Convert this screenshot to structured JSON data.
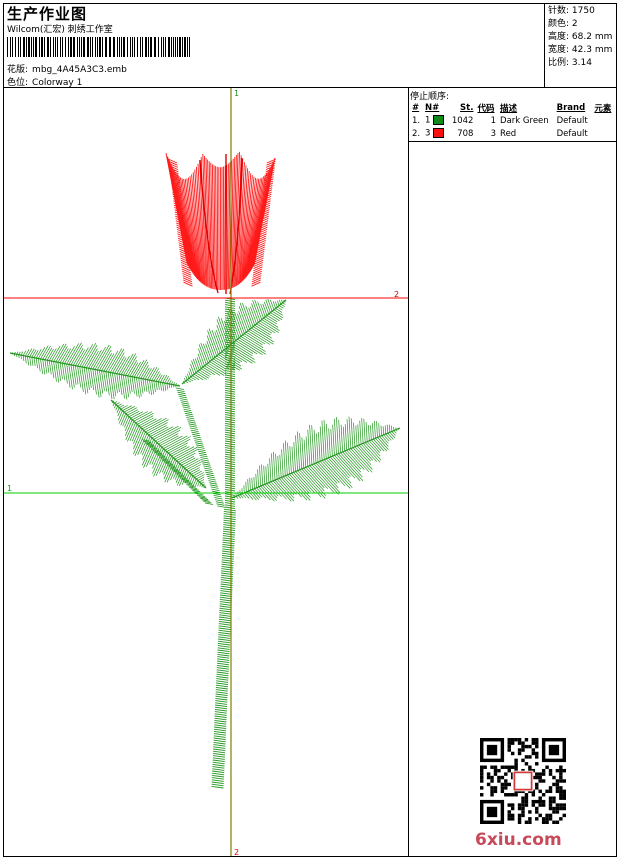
{
  "header": {
    "title": "生产作业图",
    "subtitle": "Wilcom(汇宏) 刺绣工作室",
    "design_label": "花版:",
    "design_value": "mbg_4A45A3C3.emb",
    "colorway_label": "色位:",
    "colorway_value": "Colorway 1"
  },
  "stats": [
    {
      "label": "针数:",
      "value": "1750"
    },
    {
      "label": "颜色:",
      "value": "2"
    },
    {
      "label": "高度:",
      "value": "68.2 mm"
    },
    {
      "label": "宽度:",
      "value": "42.3 mm"
    },
    {
      "label": "比例:",
      "value": "3.14"
    }
  ],
  "stop_sequence": {
    "title": "停止顺序:",
    "columns": [
      "#",
      "N#",
      "St.",
      "代码",
      "描述",
      "Brand",
      "元素"
    ],
    "rows": [
      {
        "idx": "1.",
        "n": "1",
        "color": "#0f8a17",
        "stitches": "1042",
        "code": "1",
        "desc": "Dark Green",
        "brand": "Default"
      },
      {
        "idx": "2.",
        "n": "3",
        "color": "#ff1010",
        "stitches": "708",
        "code": "3",
        "desc": "Red",
        "brand": "Default"
      }
    ]
  },
  "guides": {
    "vertical_top": "1",
    "vertical_bottom": "2",
    "red_line": "2",
    "green_line": "1"
  },
  "colors": {
    "green_thread": "#22961f",
    "red_thread": "#ff1a1a",
    "vertical_guide": "#808000",
    "red_guide": "#ff0000",
    "green_guide": "#00cc00"
  },
  "watermark": {
    "text": "6xiu.com"
  }
}
